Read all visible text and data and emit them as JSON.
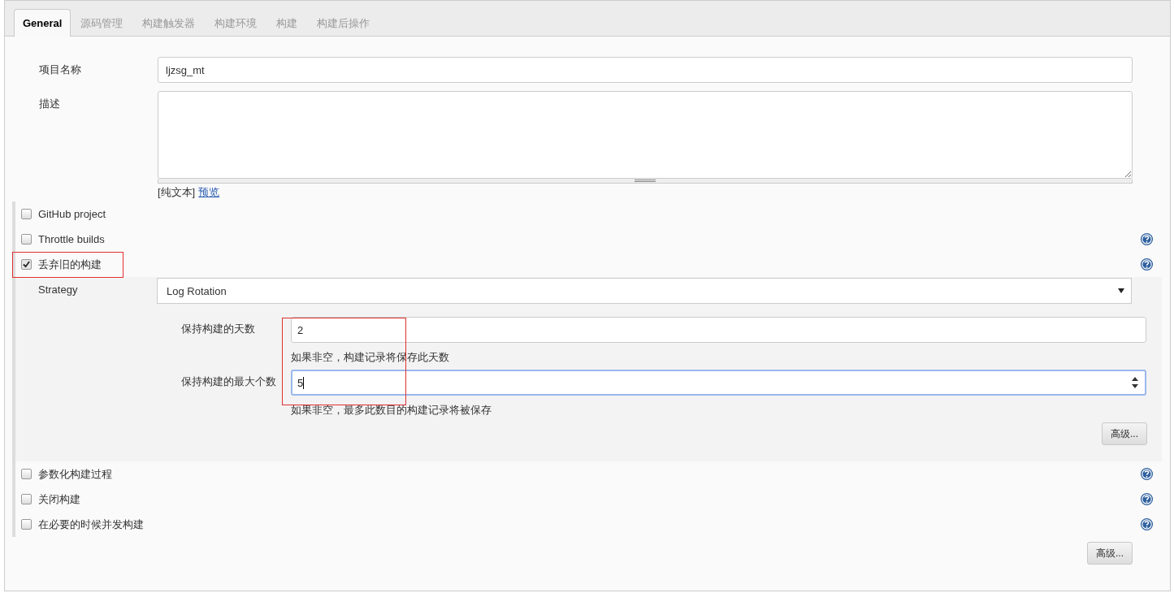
{
  "tabs": [
    {
      "label": "General",
      "selected": true
    },
    {
      "label": "源码管理",
      "selected": false
    },
    {
      "label": "构建触发器",
      "selected": false
    },
    {
      "label": "构建环境",
      "selected": false
    },
    {
      "label": "构建",
      "selected": false
    },
    {
      "label": "构建后操作",
      "selected": false
    }
  ],
  "project_name": {
    "label": "项目名称",
    "value": "ljzsg_mt"
  },
  "description": {
    "label": "描述"
  },
  "markup": {
    "format": "[纯文本]",
    "preview_link": "预览"
  },
  "options": [
    {
      "label": "GitHub project",
      "checked": false,
      "help": false,
      "highlighted": false
    },
    {
      "label": "Throttle builds",
      "checked": false,
      "help": true,
      "highlighted": false
    },
    {
      "label": "丢弃旧的构建",
      "checked": true,
      "help": true,
      "highlighted": true,
      "details": {
        "strategy_label": "Strategy",
        "strategy_value": "Log Rotation",
        "highlighted": true,
        "advanced_button": "高级...",
        "fields": [
          {
            "label": "保持构建的天数",
            "value": "2",
            "hint": "如果非空，构建记录将保存此天数",
            "kind": "text",
            "focused": false
          },
          {
            "label": "保持构建的最大个数",
            "value": "5",
            "hint": "如果非空，最多此数目的构建记录将被保存",
            "kind": "number",
            "focused": true
          }
        ]
      }
    },
    {
      "label": "参数化构建过程",
      "checked": false,
      "help": true,
      "highlighted": false
    },
    {
      "label": "关闭构建",
      "checked": false,
      "help": true,
      "highlighted": false
    },
    {
      "label": "在必要的时候并发构建",
      "checked": false,
      "help": true,
      "highlighted": false
    }
  ],
  "advanced_button": "高级..."
}
